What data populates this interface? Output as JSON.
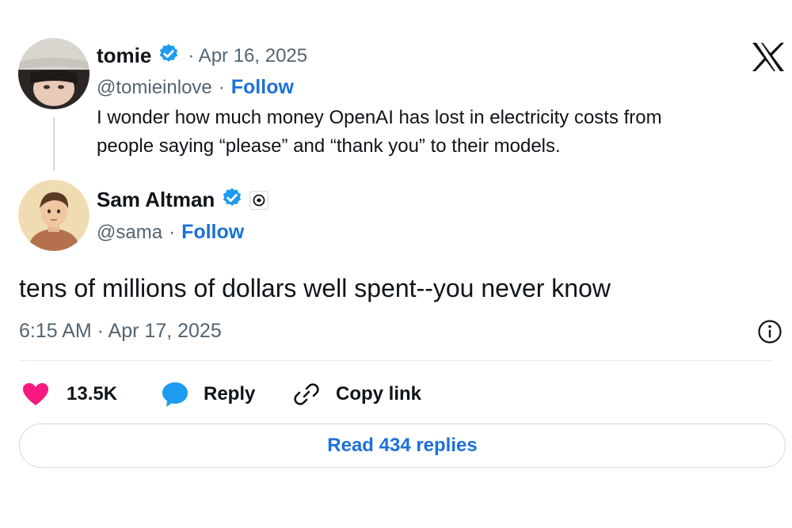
{
  "colors": {
    "verified_blue": "#1d9bf0",
    "follow_blue": "#1d70d8",
    "like_pink": "#f91880",
    "reply_blue": "#1d9bf0",
    "muted": "#536471"
  },
  "brand": {
    "logo": "x-logo-icon"
  },
  "parent_tweet": {
    "author_name": "tomie",
    "date": "· Apr 16, 2025",
    "handle": "@tomieinlove",
    "separator": "·",
    "follow_label": "Follow",
    "text_line1": "I wonder how much money OpenAI has lost in electricity costs from",
    "text_line2": "people saying “please” and “thank you” to their models."
  },
  "main_tweet": {
    "author_name": "Sam Altman",
    "handle": "@sama",
    "separator": "·",
    "follow_label": "Follow",
    "text": "tens of millions of dollars well spent--you never know",
    "timestamp": "6:15 AM · Apr 17, 2025"
  },
  "actions": {
    "likes_count": "13.5K",
    "reply_label": "Reply",
    "copy_link_label": "Copy link"
  },
  "read_replies_label": "Read 434 replies"
}
